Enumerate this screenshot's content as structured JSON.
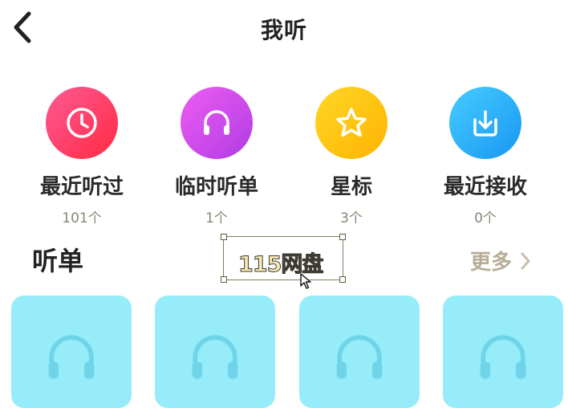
{
  "header": {
    "title": "我听"
  },
  "quick_entries": [
    {
      "label": "最近听过",
      "count": "101个",
      "icon": "clock-icon",
      "color_start": "#ff4f8f",
      "color_end": "#ff2e45"
    },
    {
      "label": "临时听单",
      "count": "1个",
      "icon": "headphones-icon",
      "color_start": "#e657f0",
      "color_end": "#b63ee6"
    },
    {
      "label": "星标",
      "count": "3个",
      "icon": "star-icon",
      "color_start": "#ffd21f",
      "color_end": "#ffb800"
    },
    {
      "label": "最近接收",
      "count": "0个",
      "icon": "download-icon",
      "color_start": "#3cc8ff",
      "color_end": "#1f9ef5"
    }
  ],
  "section": {
    "title": "听单",
    "more_label": "更多"
  },
  "watermark": {
    "text": "115网盘"
  },
  "colors": {
    "card_bg": "#96ecf8",
    "card_icon": "#6fd4ea",
    "count_text": "#8a8576",
    "more_text": "#b7ad98"
  },
  "cards": [
    {
      "icon": "headphones-icon"
    },
    {
      "icon": "headphones-icon"
    },
    {
      "icon": "headphones-icon"
    },
    {
      "icon": "headphones-icon"
    }
  ]
}
